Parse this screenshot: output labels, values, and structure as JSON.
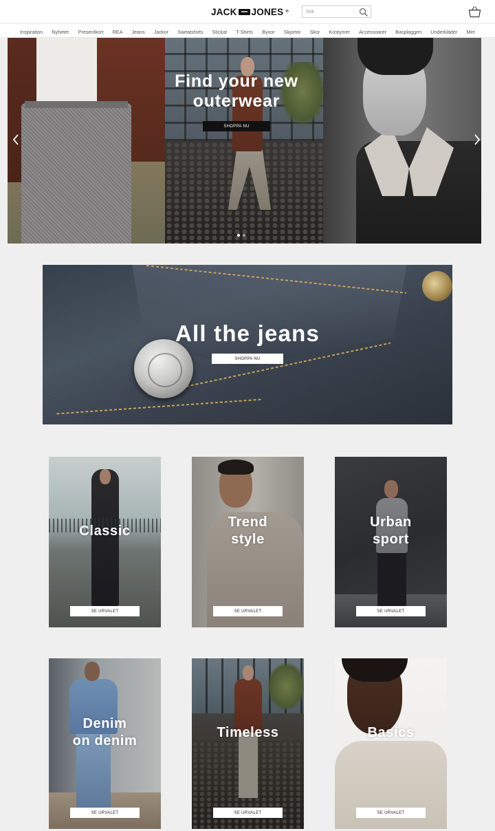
{
  "header": {
    "logo_left": "JACK",
    "logo_right": "JONES",
    "logo_reg": "®",
    "search_placeholder": "Sök"
  },
  "nav": {
    "items": [
      "Inspiration",
      "Nyheter",
      "Presentkort",
      "REA",
      "Jeans",
      "Jackor",
      "Sweatshirts",
      "Stickat",
      "T-Shirts",
      "Byxor",
      "Skjortor",
      "Skor",
      "Kostymer",
      "Accessoarer",
      "Basplaggen",
      "Underkläder",
      "Mer"
    ]
  },
  "hero": {
    "title_line1": "Find your new",
    "title_line2": "outerwear",
    "button": "SHOPPA NU",
    "slides": 3,
    "active_slide": 1
  },
  "jeans_banner": {
    "title": "All the jeans",
    "button": "SHOPPA NU"
  },
  "tiles": [
    {
      "title_line1": "Classic",
      "title_line2": "",
      "button": "SE URVALET"
    },
    {
      "title_line1": "Trend",
      "title_line2": "style",
      "button": "SE URVALET"
    },
    {
      "title_line1": "Urban",
      "title_line2": "sport",
      "button": "SE URVALET"
    },
    {
      "title_line1": "Denim",
      "title_line2": "on denim",
      "button": "SE URVALET"
    },
    {
      "title_line1": "Timeless",
      "title_line2": "",
      "button": "SE URVALET"
    },
    {
      "title_line1": "Basics",
      "title_line2": "",
      "button": "SE URVALET"
    }
  ],
  "colors": {
    "page_background": "#efefef",
    "header_background": "#ffffff",
    "primary_button": "#111111",
    "secondary_button": "#ffffff"
  }
}
